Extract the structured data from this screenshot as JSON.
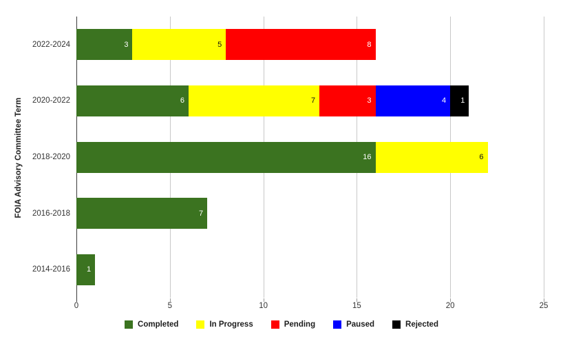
{
  "chart_data": {
    "type": "bar",
    "orientation": "horizontal",
    "stacked": true,
    "title": "",
    "xlabel": "",
    "ylabel": "FOIA Advisory Committee Term",
    "categories": [
      "2022-2024",
      "2020-2022",
      "2018-2020",
      "2016-2018",
      "2014-2016"
    ],
    "series": [
      {
        "name": "Completed",
        "color": "#3b7320",
        "values": [
          3,
          6,
          16,
          7,
          1
        ]
      },
      {
        "name": "In Progress",
        "color": "#ffff00",
        "values": [
          5,
          7,
          6,
          0,
          0
        ]
      },
      {
        "name": "Pending",
        "color": "#ff0000",
        "values": [
          8,
          3,
          0,
          0,
          0
        ]
      },
      {
        "name": "Paused",
        "color": "#0000ff",
        "values": [
          0,
          4,
          0,
          0,
          0
        ]
      },
      {
        "name": "Rejected",
        "color": "#000000",
        "values": [
          0,
          1,
          0,
          0,
          0
        ]
      }
    ],
    "totals": [
      16,
      21,
      22,
      7,
      1
    ],
    "xlim": [
      0,
      25
    ],
    "xticks": [
      0,
      5,
      10,
      15,
      20,
      25
    ],
    "xtick_labels": [
      "0",
      "5",
      "10",
      "15",
      "20",
      "25"
    ],
    "grid": "vertical",
    "legend_position": "bottom",
    "data_labels": true
  },
  "legend": {
    "items": [
      {
        "label": "Completed",
        "color": "#3b7320"
      },
      {
        "label": "In Progress",
        "color": "#ffff00"
      },
      {
        "label": "Pending",
        "color": "#ff0000"
      },
      {
        "label": "Paused",
        "color": "#0000ff"
      },
      {
        "label": "Rejected",
        "color": "#000000"
      }
    ]
  }
}
